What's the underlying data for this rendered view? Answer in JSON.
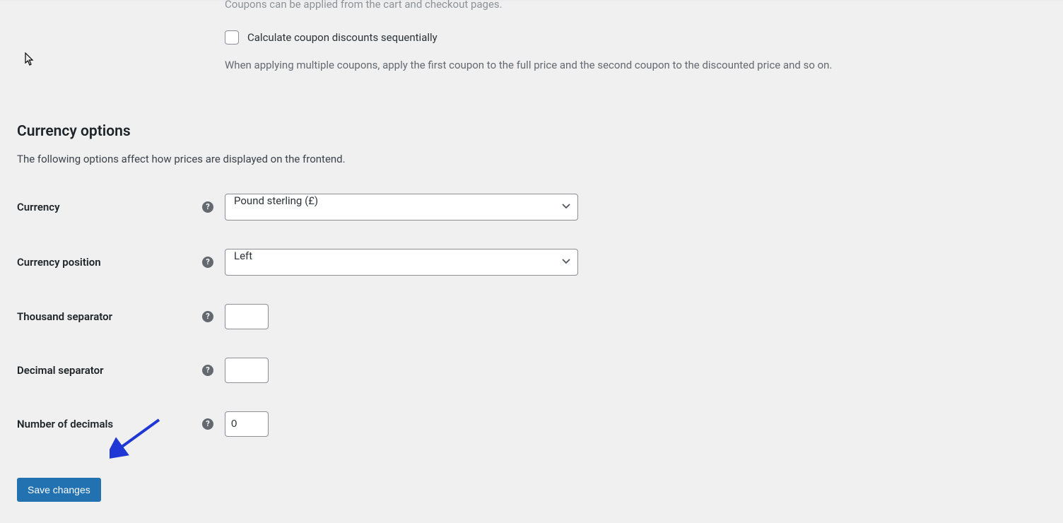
{
  "coupons": {
    "desc_top": "Coupons can be applied from the cart and checkout pages.",
    "checkbox_label": "Calculate coupon discounts sequentially",
    "checkbox_desc": "When applying multiple coupons, apply the first coupon to the full price and the second coupon to the discounted price and so on."
  },
  "currency_section": {
    "title": "Currency options",
    "desc": "The following options affect how prices are displayed on the frontend."
  },
  "fields": {
    "currency": {
      "label": "Currency",
      "value": "Pound sterling (£)"
    },
    "currency_position": {
      "label": "Currency position",
      "value": "Left"
    },
    "thousand_separator": {
      "label": "Thousand separator",
      "value": ""
    },
    "decimal_separator": {
      "label": "Decimal separator",
      "value": ""
    },
    "number_of_decimals": {
      "label": "Number of decimals",
      "value": "0"
    }
  },
  "buttons": {
    "save": "Save changes"
  }
}
